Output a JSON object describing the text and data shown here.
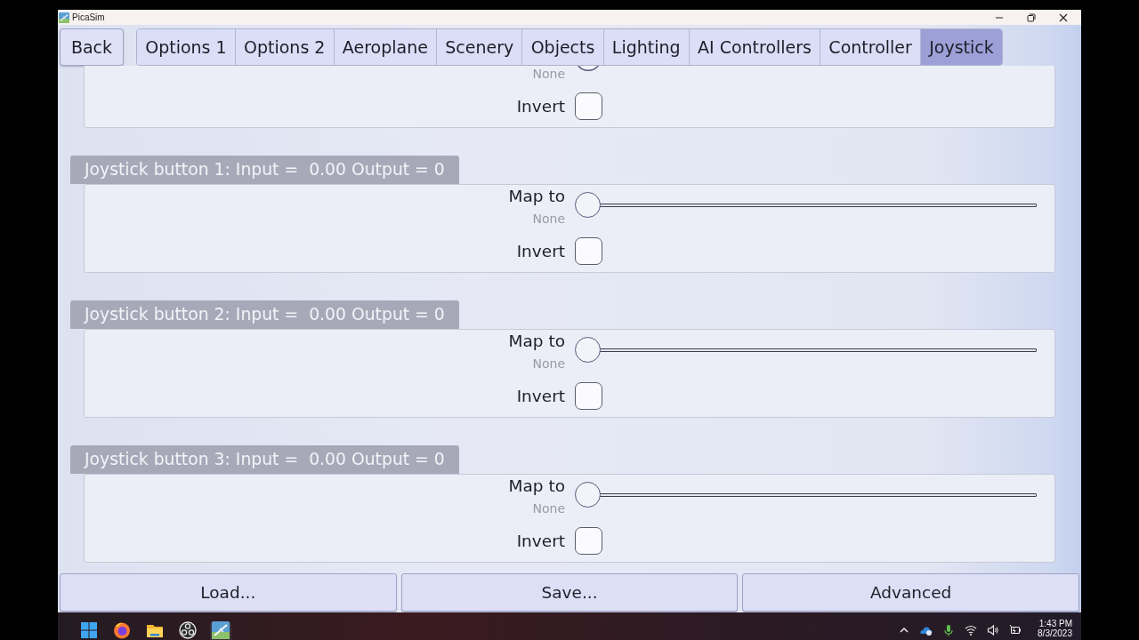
{
  "window": {
    "title": "PicaSim"
  },
  "nav": {
    "back": "Back",
    "tabs": [
      {
        "label": "Options 1",
        "selected": false
      },
      {
        "label": "Options 2",
        "selected": false
      },
      {
        "label": "Aeroplane",
        "selected": false
      },
      {
        "label": "Scenery",
        "selected": false
      },
      {
        "label": "Objects",
        "selected": false
      },
      {
        "label": "Lighting",
        "selected": false
      },
      {
        "label": "AI Controllers",
        "selected": false
      },
      {
        "label": "Controller",
        "selected": false
      },
      {
        "label": "Joystick",
        "selected": true
      }
    ]
  },
  "groups": [
    {
      "kind": "clipped",
      "map_value": "None",
      "level": 0,
      "invert_label": "Invert",
      "invert_checked": false
    },
    {
      "kind": "full",
      "title": "Joystick button 1: Input =  0.00 Output = 0",
      "map_label": "Map to",
      "map_value": "None",
      "level": 0,
      "invert_label": "Invert",
      "invert_checked": false
    },
    {
      "kind": "full",
      "title": "Joystick button 2: Input =  0.00 Output = 0",
      "map_label": "Map to",
      "map_value": "None",
      "level": 0,
      "invert_label": "Invert",
      "invert_checked": false
    },
    {
      "kind": "full",
      "title": "Joystick button 3: Input =  0.00 Output = 0",
      "map_label": "Map to",
      "map_value": "None",
      "level": 0,
      "invert_label": "Invert",
      "invert_checked": false
    }
  ],
  "buttons": [
    "Load...",
    "Save...",
    "Advanced"
  ],
  "taskbar": {
    "time": "1:43 PM",
    "date": "8/3/2023"
  }
}
